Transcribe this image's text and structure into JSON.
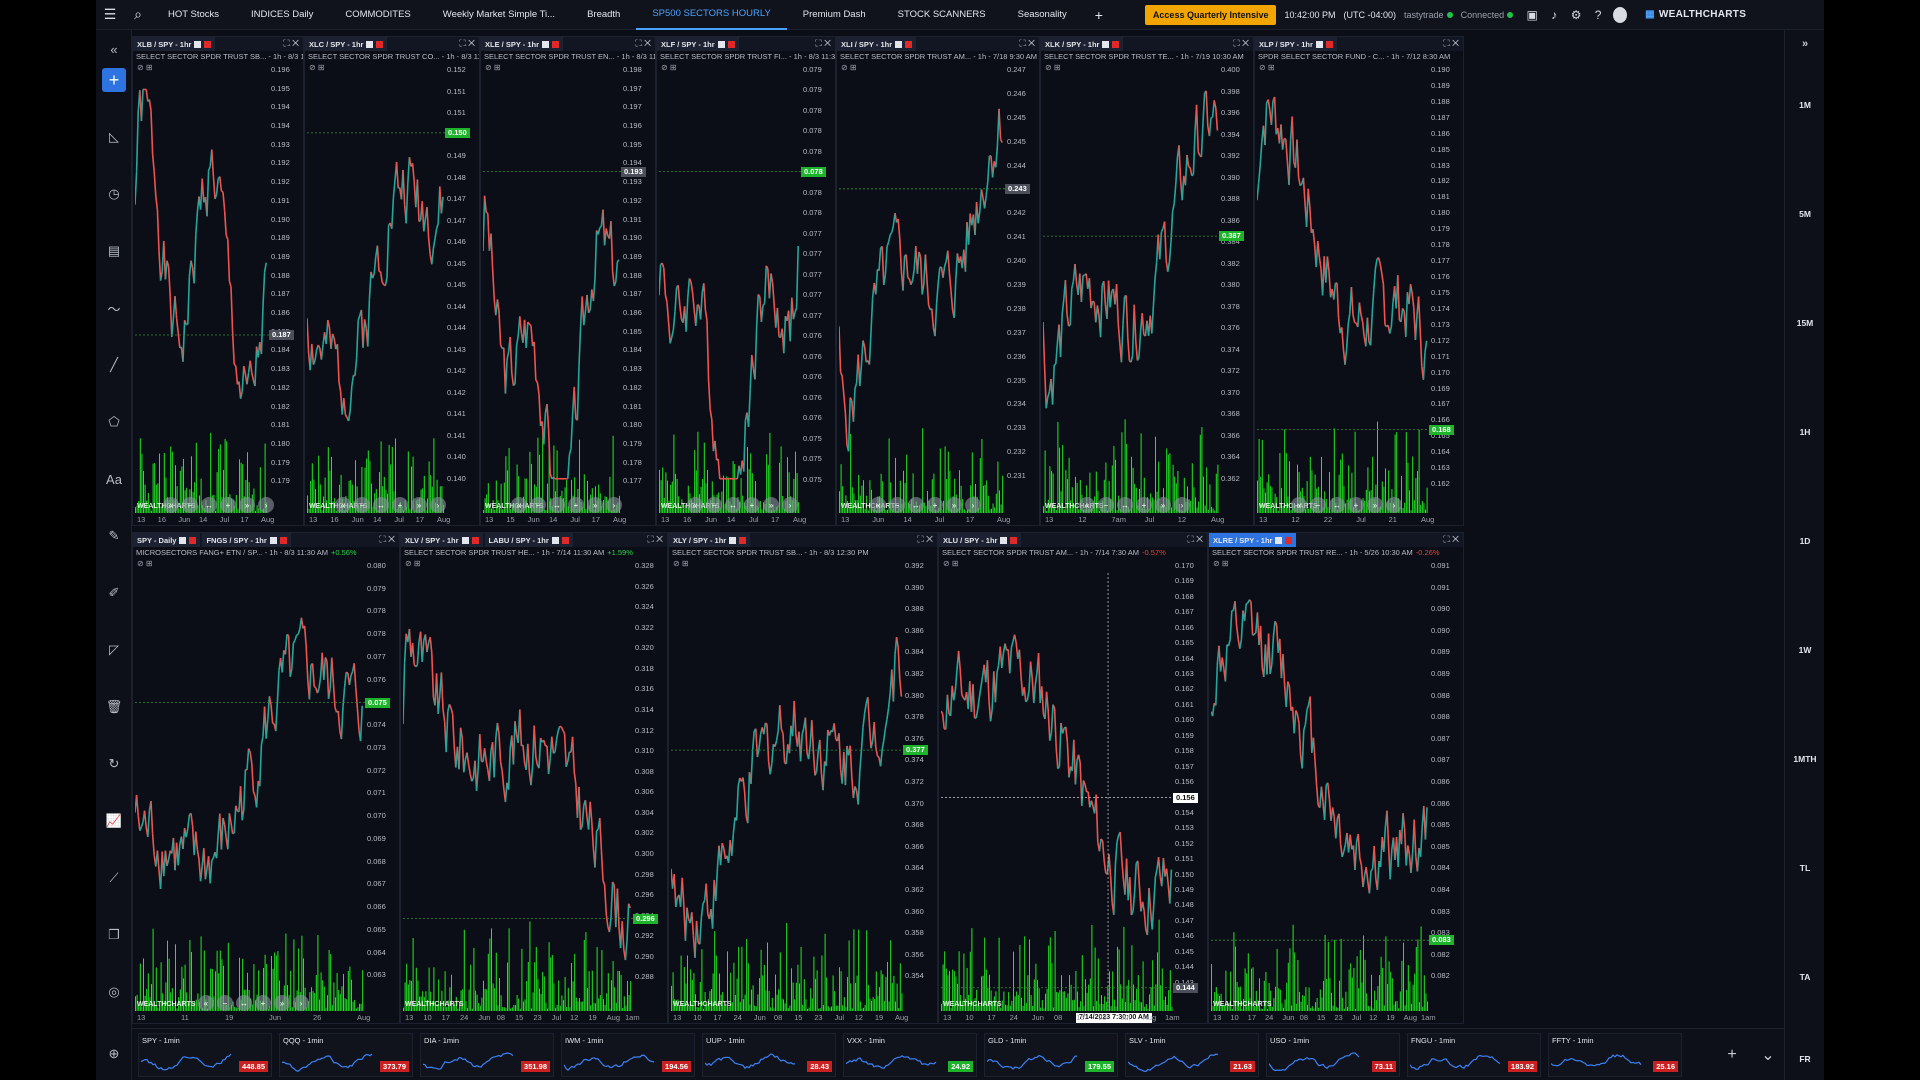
{
  "nav": {
    "tabs": [
      {
        "label": "HOT Stocks",
        "active": false
      },
      {
        "label": "INDICES Daily",
        "active": false
      },
      {
        "label": "COMMODITES",
        "active": false
      },
      {
        "label": "Weekly Market Simple Ti...",
        "active": false
      },
      {
        "label": "Breadth",
        "active": false
      },
      {
        "label": "SP500 SECTORS HOURLY",
        "active": true
      },
      {
        "label": "Premium Dash",
        "active": false
      },
      {
        "label": "STOCK SCANNERS",
        "active": false
      },
      {
        "label": "Seasonality",
        "active": false
      }
    ],
    "add_tab": "+",
    "promo": "Access Quarterly Intensive",
    "time": "10:42:00 PM",
    "timezone": "(UTC -04:00)",
    "broker": "tastytrade",
    "connection": "Connected",
    "brand": "WEALTHCHARTS"
  },
  "timeframes": [
    "1M",
    "5M",
    "15M",
    "1H",
    "1D",
    "1W",
    "1MTH",
    "TL",
    "TA",
    "FR"
  ],
  "panels": [
    {
      "syms": [
        "XLB / SPY - 1hr"
      ],
      "desc": "SELECT SECTOR SPDR TRUST SB... - 1h - 8/3 11:30 AM",
      "chg": "",
      "ticks": [
        "0.196",
        "0.195",
        "0.194",
        "0.194",
        "0.193",
        "0.192",
        "0.192",
        "0.191",
        "0.190",
        "0.189",
        "0.189",
        "0.188",
        "0.187",
        "0.186",
        "0.185",
        "0.184",
        "0.183",
        "0.182",
        "0.182",
        "0.181",
        "0.180",
        "0.179",
        "0.179"
      ],
      "price": "0.187",
      "price_pos": 0.6,
      "price_style": "gr",
      "xlabels": [
        "13",
        "16",
        "Jun",
        "14",
        "Jul",
        "17",
        "Aug"
      ],
      "seed": 1,
      "trend": "down-volatile"
    },
    {
      "syms": [
        "XLC / SPY - 1hr"
      ],
      "desc": "SELECT SECTOR SPDR TRUST CO... - 1h - 8/3 11:30 AM",
      "chg": "",
      "ticks": [
        "0.152",
        "0.151",
        "0.151",
        "0.150",
        "0.149",
        "0.148",
        "0.147",
        "0.147",
        "0.146",
        "0.145",
        "0.145",
        "0.144",
        "0.144",
        "0.143",
        "0.142",
        "0.142",
        "0.141",
        "0.141",
        "0.140",
        "0.140"
      ],
      "price": "0.150",
      "price_pos": 0.13,
      "price_style": "g",
      "xlabels": [
        "13",
        "16",
        "Jun",
        "14",
        "Jul",
        "17",
        "Aug"
      ],
      "seed": 2,
      "trend": "up"
    },
    {
      "syms": [
        "XLE / SPY - 1hr"
      ],
      "desc": "SELECT SECTOR SPDR TRUST EN... - 1h - 8/3 11:30 AM",
      "chg": "",
      "ticks": [
        "0.198",
        "0.197",
        "0.197",
        "0.196",
        "0.195",
        "0.194",
        "0.193",
        "0.192",
        "0.191",
        "0.190",
        "0.189",
        "0.188",
        "0.187",
        "0.186",
        "0.185",
        "0.184",
        "0.183",
        "0.182",
        "0.181",
        "0.180",
        "0.179",
        "0.178",
        "0.177"
      ],
      "price": "0.193",
      "price_pos": 0.22,
      "price_style": "gr",
      "xlabels": [
        "13",
        "15",
        "Jun",
        "14",
        "Jul",
        "17",
        "Aug"
      ],
      "seed": 3,
      "trend": "v"
    },
    {
      "syms": [
        "XLF / SPY - 1hr"
      ],
      "desc": "SELECT SECTOR SPDR TRUST FI... - 1h - 8/3 11:30 AM",
      "chg": "",
      "ticks": [
        "0.079",
        "0.079",
        "0.078",
        "0.078",
        "0.078",
        "0.078",
        "0.078",
        "0.078",
        "0.077",
        "0.077",
        "0.077",
        "0.077",
        "0.077",
        "0.076",
        "0.076",
        "0.076",
        "0.076",
        "0.076",
        "0.075",
        "0.075",
        "0.075"
      ],
      "price": "0.078",
      "price_pos": 0.22,
      "price_style": "g",
      "xlabels": [
        "13",
        "16",
        "Jun",
        "14",
        "Jul",
        "17",
        "Aug"
      ],
      "seed": 4,
      "trend": "v"
    },
    {
      "syms": [
        "XLI / SPY - 1hr"
      ],
      "desc": "SELECT SECTOR SPDR TRUST AM... - 1h - 7/18 9:30 AM",
      "chg": "",
      "ticks": [
        "0.247",
        "0.246",
        "0.245",
        "0.245",
        "0.244",
        "0.243",
        "0.242",
        "0.241",
        "0.240",
        "0.239",
        "0.238",
        "0.237",
        "0.236",
        "0.235",
        "0.234",
        "0.233",
        "0.232",
        "0.231"
      ],
      "price": "0.243",
      "price_pos": 0.26,
      "price_style": "gr",
      "xlabels": [
        "13",
        "Jun",
        "14",
        "Jul",
        "17",
        "Aug"
      ],
      "seed": 5,
      "trend": "up"
    },
    {
      "syms": [
        "XLK / SPY - 1hr"
      ],
      "desc": "SELECT SECTOR SPDR TRUST TE... - 1h - 7/19 10:30 AM",
      "chg": "",
      "ticks": [
        "0.400",
        "0.398",
        "0.396",
        "0.394",
        "0.392",
        "0.390",
        "0.388",
        "0.386",
        "0.384",
        "0.382",
        "0.380",
        "0.378",
        "0.376",
        "0.374",
        "0.372",
        "0.370",
        "0.368",
        "0.366",
        "0.364",
        "0.362"
      ],
      "price": "0.387",
      "price_pos": 0.37,
      "price_style": "g",
      "xlabels": [
        "13",
        "12",
        "7am",
        "Jul",
        "12",
        "Aug"
      ],
      "seed": 6,
      "trend": "up"
    },
    {
      "syms": [
        "XLP / SPY - 1hr"
      ],
      "desc": "SPDR SELECT SECTOR FUND - C... - 1h - 7/12 8:30 AM",
      "chg": "",
      "ticks": [
        "0.190",
        "0.189",
        "0.188",
        "0.187",
        "0.186",
        "0.185",
        "0.183",
        "0.182",
        "0.181",
        "0.180",
        "0.179",
        "0.178",
        "0.177",
        "0.176",
        "0.175",
        "0.174",
        "0.173",
        "0.172",
        "0.171",
        "0.170",
        "0.169",
        "0.167",
        "0.166",
        "0.165",
        "0.164",
        "0.163",
        "0.162"
      ],
      "price": "0.168",
      "price_pos": 0.82,
      "price_style": "g",
      "xlabels": [
        "13",
        "12",
        "22",
        "Jul",
        "21",
        "Aug"
      ],
      "seed": 7,
      "trend": "down"
    },
    {
      "syms": [
        "SPY - Daily",
        "FNGS / SPY - 1hr"
      ],
      "desc": "MICROSECTORS FANG+ ETN / SP... - 1h - 8/3 11:30 AM",
      "chg": "+0.56%",
      "chg_dir": "up",
      "ticks": [
        "0.080",
        "0.079",
        "0.078",
        "0.078",
        "0.077",
        "0.076",
        "0.075",
        "0.074",
        "0.073",
        "0.072",
        "0.071",
        "0.070",
        "0.069",
        "0.068",
        "0.067",
        "0.066",
        "0.065",
        "0.064",
        "0.063"
      ],
      "price": "0.075",
      "price_pos": 0.3,
      "price_style": "g",
      "xlabels": [
        "13",
        "11",
        "19",
        "Jun",
        "26",
        "Aug"
      ],
      "seed": 8,
      "trend": "up"
    },
    {
      "syms": [
        "XLV / SPY - 1hr",
        "LABU / SPY - 1hr"
      ],
      "desc": "SELECT SECTOR SPDR TRUST HE... - 1h - 7/14 11:30 AM",
      "chg": "+1.59%",
      "chg_dir": "up",
      "ticks": [
        "0.328",
        "0.326",
        "0.324",
        "0.322",
        "0.320",
        "0.318",
        "0.316",
        "0.314",
        "0.312",
        "0.310",
        "0.308",
        "0.306",
        "0.304",
        "0.302",
        "0.300",
        "0.298",
        "0.296",
        "0.294",
        "0.292",
        "0.290",
        "0.288"
      ],
      "price": "0.296",
      "price_pos": 0.8,
      "price_style": "g",
      "xlabels": [
        "13",
        "10",
        "17",
        "24",
        "Jun",
        "08",
        "15",
        "23",
        "Jul",
        "12",
        "19",
        "Aug",
        "1am"
      ],
      "seed": 9,
      "trend": "down"
    },
    {
      "syms": [
        "XLY / SPY - 1hr"
      ],
      "desc": "SELECT SECTOR SPDR TRUST SB... - 1h - 8/3 12:30 PM",
      "chg": "",
      "ticks": [
        "0.392",
        "0.390",
        "0.388",
        "0.386",
        "0.384",
        "0.382",
        "0.380",
        "0.378",
        "0.376",
        "0.374",
        "0.372",
        "0.370",
        "0.368",
        "0.366",
        "0.364",
        "0.362",
        "0.360",
        "0.358",
        "0.356",
        "0.354"
      ],
      "price": "0.377",
      "price_pos": 0.41,
      "price_style": "g",
      "xlabels": [
        "13",
        "10",
        "17",
        "24",
        "Jun",
        "08",
        "15",
        "23",
        "Jul",
        "12",
        "19",
        "Aug"
      ],
      "seed": 10,
      "trend": "up"
    },
    {
      "syms": [
        "XLU / SPY - 1hr"
      ],
      "desc": "SELECT SECTOR SPDR TRUST AM... - 1h - 7/14 7:30 AM",
      "chg": "-0.57%",
      "chg_dir": "down",
      "ticks": [
        "0.170",
        "0.169",
        "0.168",
        "0.167",
        "0.166",
        "0.165",
        "0.164",
        "0.163",
        "0.162",
        "0.161",
        "0.160",
        "0.159",
        "0.158",
        "0.157",
        "0.156",
        "0.155",
        "0.154",
        "0.153",
        "0.152",
        "0.151",
        "0.150",
        "0.149",
        "0.148",
        "0.147",
        "0.146",
        "0.145",
        "0.144",
        "0.143"
      ],
      "price": "0.144",
      "price_pos": 0.96,
      "price_style": "gr",
      "cross_price": "0.156",
      "cross_pos": 0.52,
      "cross_date": "7/14/2023 7:30:00 AM",
      "xlabels": [
        "13",
        "10",
        "17",
        "24",
        "Jun",
        "08",
        "15",
        "23",
        "Jul",
        "Aug",
        "1am"
      ],
      "seed": 11,
      "trend": "down"
    },
    {
      "syms": [
        "XLRE / SPY - 1hr"
      ],
      "desc": "SELECT SECTOR SPDR TRUST RE... - 1h - 5/26 10:30 AM",
      "chg": "-0.26%",
      "chg_dir": "down",
      "ticks": [
        "0.091",
        "0.091",
        "0.090",
        "0.090",
        "0.089",
        "0.089",
        "0.088",
        "0.088",
        "0.087",
        "0.087",
        "0.086",
        "0.086",
        "0.085",
        "0.085",
        "0.084",
        "0.084",
        "0.083",
        "0.083",
        "0.082",
        "0.082"
      ],
      "price": "0.083",
      "price_pos": 0.85,
      "price_style": "g",
      "xlabels": [
        "13",
        "10",
        "17",
        "24",
        "Jun",
        "08",
        "15",
        "23",
        "Jul",
        "12",
        "19",
        "Aug",
        "1am"
      ],
      "seed": 12,
      "trend": "down"
    }
  ],
  "watermark": "WEALTHCHARTS",
  "tickers": [
    {
      "name": "SPY - 1min",
      "price": "448.85",
      "dir": "red"
    },
    {
      "name": "QQQ - 1min",
      "price": "373.79",
      "dir": "red"
    },
    {
      "name": "DIA - 1min",
      "price": "351.98",
      "dir": "red"
    },
    {
      "name": "IWM - 1min",
      "price": "194.56",
      "dir": "red"
    },
    {
      "name": "UUP - 1min",
      "price": "28.43",
      "dir": "red"
    },
    {
      "name": "VXX - 1min",
      "price": "24.92",
      "dir": "green"
    },
    {
      "name": "GLD - 1min",
      "price": "179.55",
      "dir": "green"
    },
    {
      "name": "SLV - 1min",
      "price": "21.63",
      "dir": "red"
    },
    {
      "name": "USO - 1min",
      "price": "73.11",
      "dir": "red"
    },
    {
      "name": "FNGU - 1min",
      "price": "183.92",
      "dir": "red"
    },
    {
      "name": "FFTY - 1min",
      "price": "25.16",
      "dir": "red"
    }
  ],
  "colors": {
    "up": "#26a69a",
    "down": "#ef5350",
    "volume": "#22ff22",
    "accent": "#2d74e0",
    "promo": "#f2a500"
  }
}
